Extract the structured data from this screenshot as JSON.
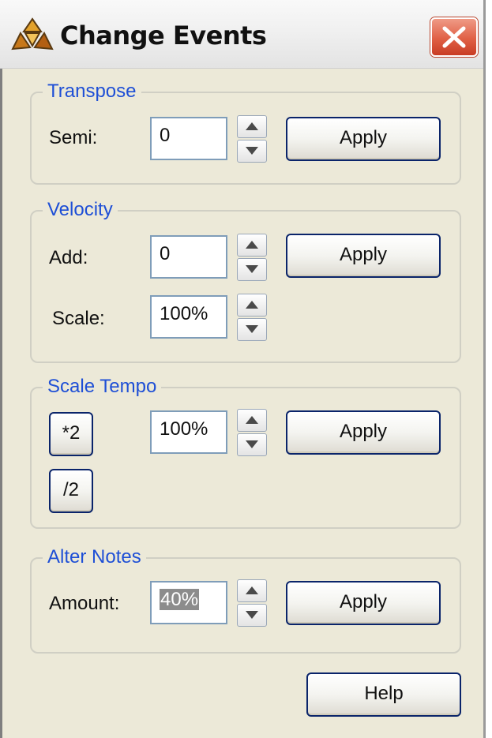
{
  "window": {
    "title": "Change Events",
    "icon": "propellerhead-icon",
    "close_icon": "close-icon"
  },
  "transpose": {
    "legend": "Transpose",
    "semi_label": "Semi:",
    "semi_value": "0",
    "apply_label": "Apply"
  },
  "velocity": {
    "legend": "Velocity",
    "add_label": "Add:",
    "add_value": "0",
    "apply_label": "Apply",
    "scale_label": "Scale:",
    "scale_value": "100%"
  },
  "scale_tempo": {
    "legend": "Scale Tempo",
    "double_label": "*2",
    "half_label": "/2",
    "value": "100%",
    "apply_label": "Apply"
  },
  "alter_notes": {
    "legend": "Alter Notes",
    "amount_label": "Amount:",
    "amount_value": "40%",
    "apply_label": "Apply"
  },
  "footer": {
    "help_label": "Help"
  },
  "colors": {
    "legend": "#1e4fd6",
    "face": "#ece9d8",
    "close": "#e06045"
  }
}
